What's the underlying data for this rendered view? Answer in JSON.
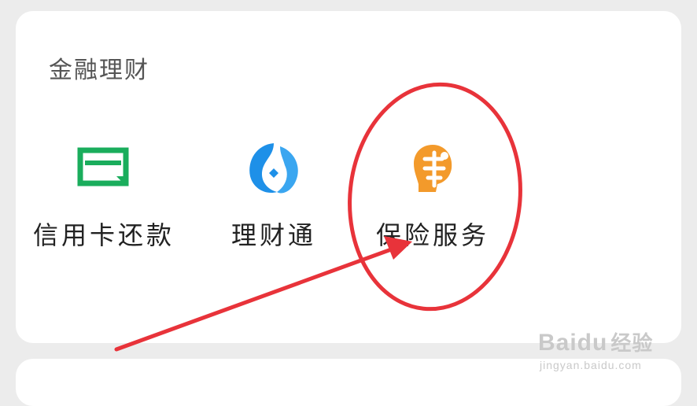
{
  "section": {
    "title": "金融理财"
  },
  "services": [
    {
      "label": "信用卡还款",
      "icon": "credit-card-repay-icon",
      "color": "#1aad5c"
    },
    {
      "label": "理财通",
      "icon": "licaitong-fish-icon",
      "color": "#1e90e8"
    },
    {
      "label": "保险服务",
      "icon": "insurance-service-icon",
      "color": "#f39a2b"
    }
  ],
  "annotation": {
    "highlight_color": "#e8333a"
  },
  "watermark": {
    "brand": "Baidu",
    "brand_suffix": "经验",
    "url": "jingyan.baidu.com"
  }
}
